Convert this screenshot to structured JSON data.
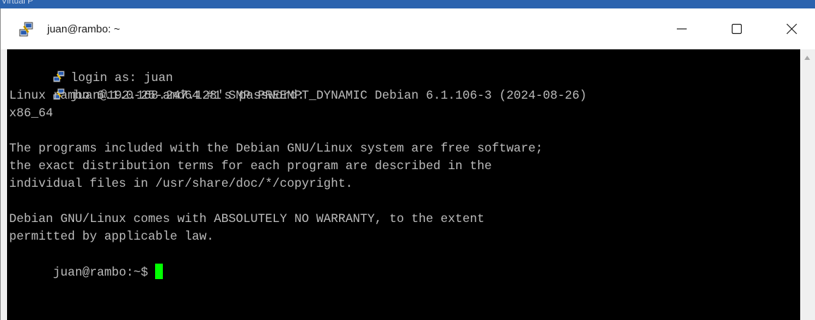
{
  "desktop": {
    "behind_window_text": "Virtual P"
  },
  "window": {
    "title": "juan@rambo: ~",
    "app_icon": "putty-icon",
    "controls": {
      "minimize": "minimize-icon",
      "maximize": "maximize-icon",
      "close": "close-icon"
    }
  },
  "terminal": {
    "background": "#000000",
    "foreground": "#bbbbbb",
    "cursor_color": "#00ff00",
    "lines": [
      "login as: juan",
      "juan@192.168.247.128's password:",
      "Linux rambo 6.1.0-25-amd64 #1 SMP PREEMPT_DYNAMIC Debian 6.1.106-3 (2024-08-26)",
      "x86_64",
      "",
      "The programs included with the Debian GNU/Linux system are free software;",
      "the exact distribution terms for each program are described in the",
      "individual files in /usr/share/doc/*/copyright.",
      "",
      "Debian GNU/Linux comes with ABSOLUTELY NO WARRANTY, to the extent",
      "permitted by applicable law.",
      "juan@rambo:~$ "
    ]
  }
}
